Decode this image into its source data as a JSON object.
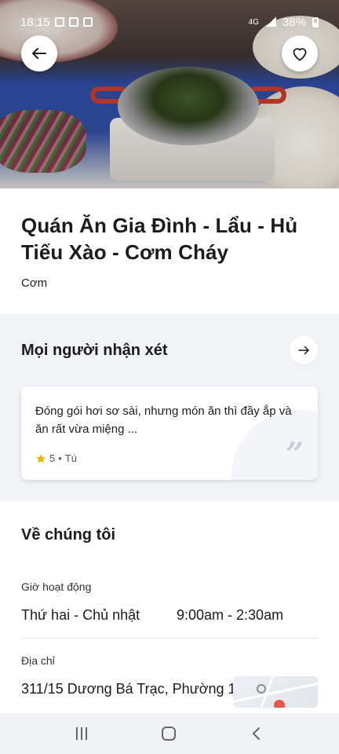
{
  "status_bar": {
    "time": "18:15",
    "battery": "38%",
    "network": "4G"
  },
  "header": {
    "back_icon": "arrow-left-icon",
    "favorite_icon": "heart-outline-icon"
  },
  "restaurant": {
    "name": "Quán Ăn Gia Đình - Lẩu - Hủ Tiếu Xào - Cơm Cháy",
    "category": "Cơm"
  },
  "reviews": {
    "section_title": "Mọi người nhận xét",
    "more_icon": "arrow-right-icon",
    "items": [
      {
        "text": "Đóng gói hơi sơ sài, nhưng món ăn thì đầy ắp và ăn rất vừa miệng ...",
        "rating": "5",
        "separator": "•",
        "author": "Tú",
        "star_color": "#f5b300"
      }
    ]
  },
  "about": {
    "section_title": "Về chúng tôi",
    "hours_label": "Giờ hoạt động",
    "hours_days": "Thứ hai - Chủ nhật",
    "hours_time": "9:00am - 2:30am",
    "address_label": "Địa chỉ",
    "address": "311/15 Dương Bá Trạc, Phường 1,"
  },
  "colors": {
    "section_bg": "#f2f3f7",
    "star": "#f5b300",
    "text": "#1c1c1c"
  }
}
